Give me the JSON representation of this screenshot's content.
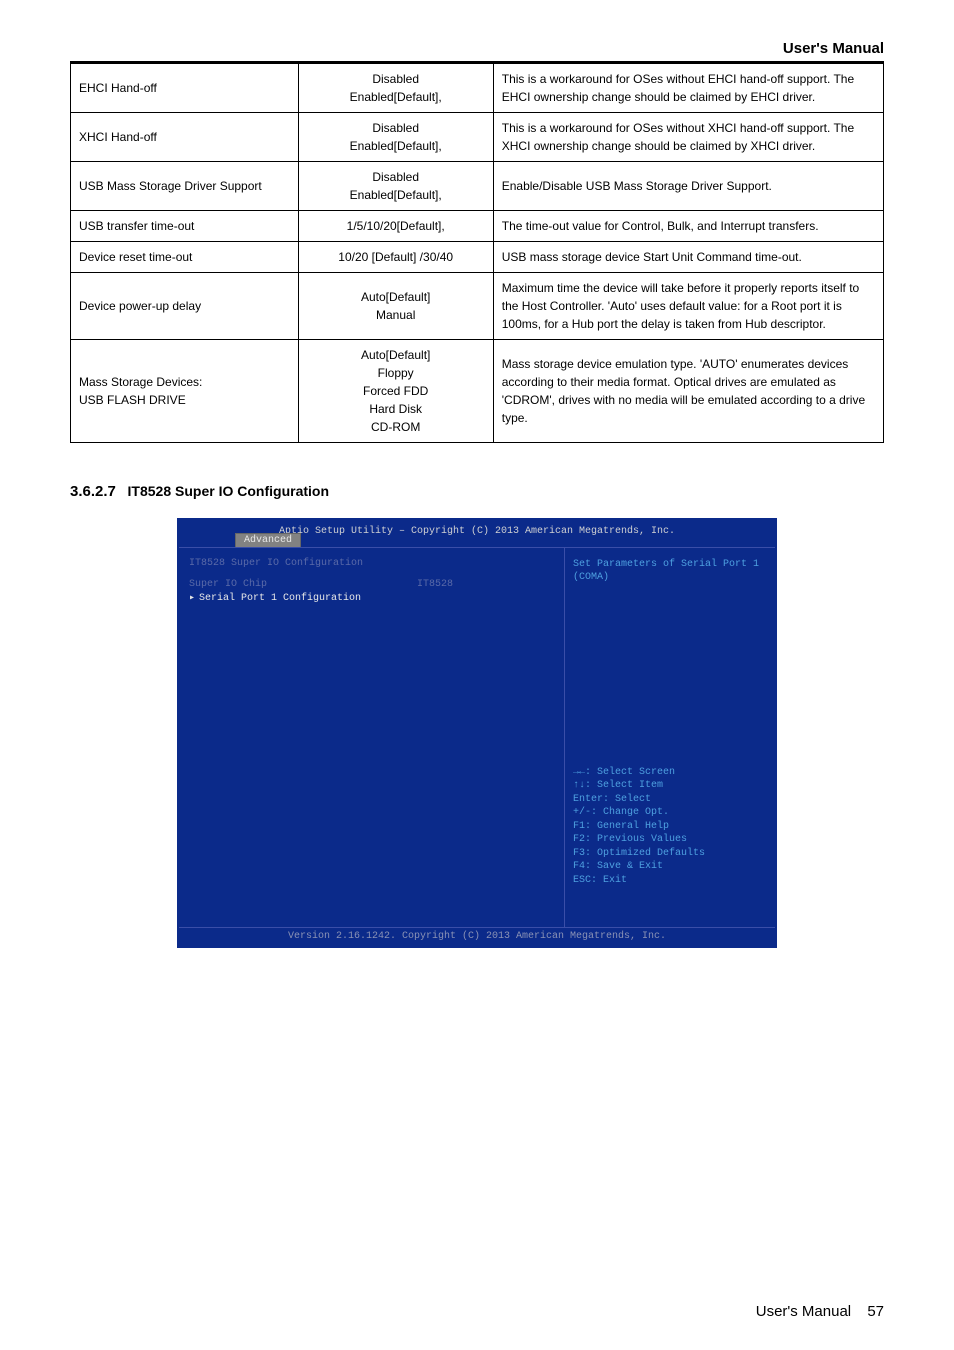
{
  "header": {
    "title": "User's Manual"
  },
  "table_rows": [
    {
      "c1": "EHCI Hand-off",
      "c2": "Disabled\nEnabled[Default],",
      "c3": "This is a workaround for OSes without EHCI hand-off support. The EHCI ownership change should be claimed by EHCI driver."
    },
    {
      "c1": "XHCI Hand-off",
      "c2": "Disabled\nEnabled[Default],",
      "c3": "This is a workaround for OSes without XHCI hand-off support. The XHCI ownership change should be claimed by XHCI driver."
    },
    {
      "c1": "USB Mass Storage Driver Support",
      "c2": "Disabled\nEnabled[Default],",
      "c3": "Enable/Disable USB Mass Storage Driver Support."
    },
    {
      "c1": "USB transfer time-out",
      "c2": "1/5/10/20[Default],",
      "c3": "The time-out value for Control, Bulk, and Interrupt transfers."
    },
    {
      "c1": "Device reset time-out",
      "c2": "10/20 [Default] /30/40",
      "c3": "USB mass storage device Start Unit Command time-out."
    },
    {
      "c1": "Device power-up delay",
      "c2": "Auto[Default]\nManual",
      "c3": "Maximum time the device will take before it properly reports itself to the Host Controller. 'Auto' uses default value: for a Root port it is 100ms, for a Hub port the delay is taken from Hub descriptor."
    },
    {
      "c1": "Mass Storage Devices:\nUSB FLASH DRIVE",
      "c2": "Auto[Default]\nFloppy\nForced FDD\nHard Disk\nCD-ROM",
      "c3": "Mass storage device emulation type. 'AUTO' enumerates devices according to their media format. Optical drives are emulated as 'CDROM', drives with no media will be emulated according to a drive type."
    }
  ],
  "section": {
    "number": "3.6.2.7",
    "title": "IT8528 Super IO Configuration"
  },
  "bios": {
    "topbar_title": "Aptio Setup Utility – Copyright (C) 2013 American Megatrends, Inc.",
    "tab": "Advanced",
    "left": {
      "heading": "IT8528 Super IO Configuration",
      "chip_label": "Super IO Chip",
      "chip_value": "IT8528",
      "serial_item": "Serial Port 1 Configuration"
    },
    "help_top": "Set Parameters of Serial Port 1 (COMA)",
    "keys": [
      "→←: Select Screen",
      "↑↓: Select Item",
      "Enter: Select",
      "+/-: Change Opt.",
      "F1: General Help",
      "F2: Previous Values",
      "F3: Optimized Defaults",
      "F4: Save & Exit",
      "ESC: Exit"
    ],
    "bottombar": "Version 2.16.1242. Copyright (C) 2013 American Megatrends, Inc."
  },
  "footer": {
    "label": "User's Manual",
    "page": "57"
  }
}
